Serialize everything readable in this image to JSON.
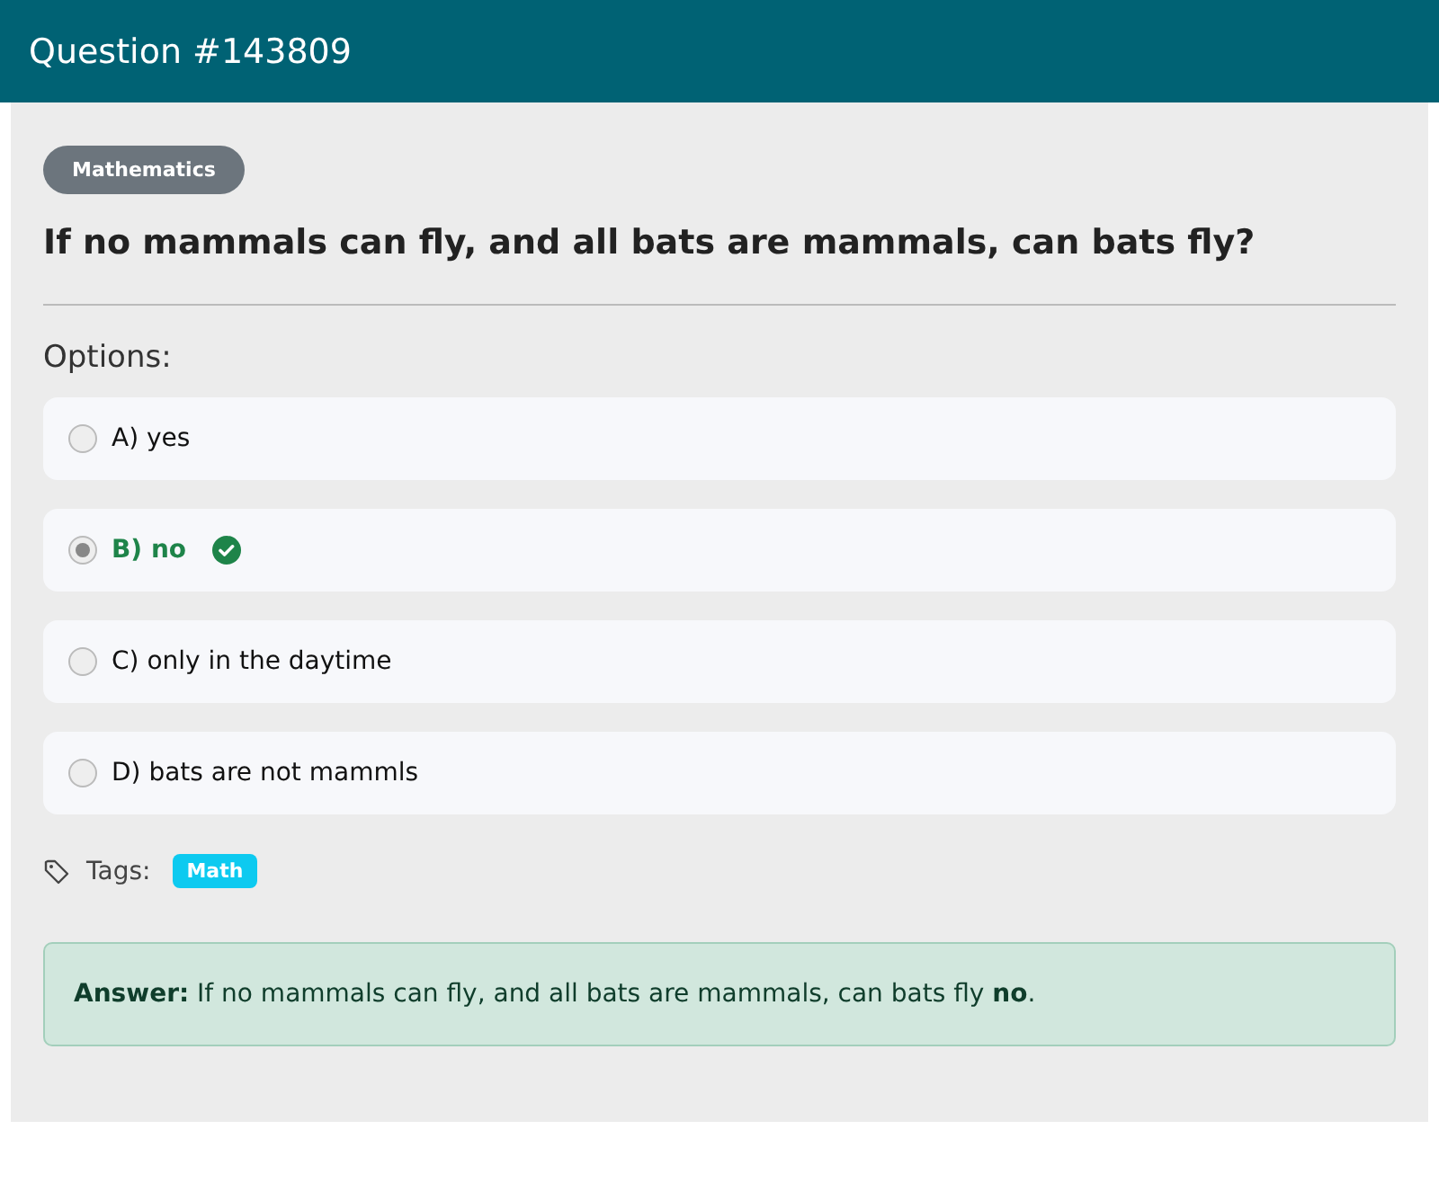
{
  "header": {
    "title": "Question #143809"
  },
  "category": "Mathematics",
  "question": "If no mammals can fly, and all bats are mammals, can bats fly?",
  "options_label": "Options:",
  "options": [
    {
      "label": "A) yes",
      "selected": false,
      "correct": false
    },
    {
      "label": "B) no",
      "selected": true,
      "correct": true
    },
    {
      "label": "C) only in the daytime",
      "selected": false,
      "correct": false
    },
    {
      "label": "D) bats are not mammls",
      "selected": false,
      "correct": false
    }
  ],
  "tags_label": "Tags:",
  "tags": [
    "Math"
  ],
  "answer": "**Answer:** If no mammals can fly, and all bats are mammals, can bats fly **no**."
}
